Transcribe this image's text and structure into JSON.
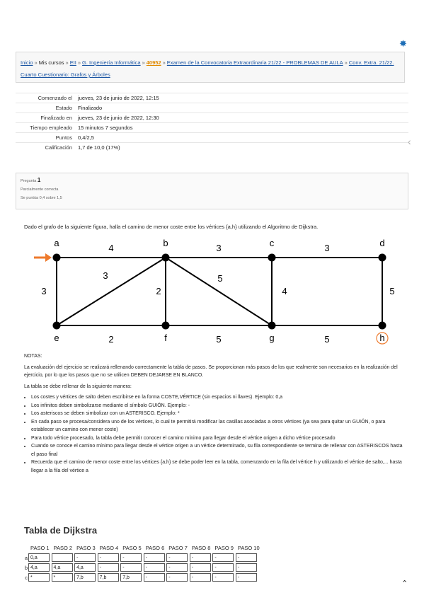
{
  "breadcrumb": {
    "items": [
      {
        "text": "Inicio",
        "link": true
      },
      {
        "text": "Mis cursos",
        "link": false
      },
      {
        "text": "EII",
        "link": true
      },
      {
        "text": "G. Ingeniería Informática",
        "link": true
      },
      {
        "text": "40952",
        "link": true,
        "highlight": true
      },
      {
        "text": "Examen de la Convocatoria Extraordinaria 21/22 - PROBLEMAS DE AULA",
        "link": true
      },
      {
        "text": "Conv. Extra. 21/22. Cuarto Cuestionario: Grafos y Árboles",
        "link": true
      }
    ],
    "separator": "»"
  },
  "summary": [
    {
      "label": "Comenzado el",
      "value": "jueves, 23 de junio de 2022, 12:15"
    },
    {
      "label": "Estado",
      "value": "Finalizado"
    },
    {
      "label": "Finalizado en",
      "value": "jueves, 23 de junio de 2022, 12:30"
    },
    {
      "label": "Tiempo empleado",
      "value": "15 minutos 7 segundos"
    },
    {
      "label": "Puntos",
      "value": "0,4/2,5"
    },
    {
      "label": "Calificación",
      "value": "1,7 de 10,0 (17%)"
    }
  ],
  "question_info": {
    "label": "Pregunta",
    "number": "1",
    "status": "Parcialmente correcta",
    "score": "Se puntúa 0,4 sobre 1,5"
  },
  "question_text": "Dado el grafo de la siguiente figura, halla el camino de menor coste entre los vértices {a,h} utilizando el Algoritmo de Dijkstra.",
  "graph": {
    "nodes": [
      "a",
      "b",
      "c",
      "d",
      "e",
      "f",
      "g",
      "h"
    ],
    "edges": [
      {
        "from": "a",
        "to": "b",
        "w": "4"
      },
      {
        "from": "b",
        "to": "c",
        "w": "3"
      },
      {
        "from": "c",
        "to": "d",
        "w": "3"
      },
      {
        "from": "a",
        "to": "e",
        "w": "3"
      },
      {
        "from": "e",
        "to": "b",
        "w": "3"
      },
      {
        "from": "b",
        "to": "f",
        "w": "2"
      },
      {
        "from": "b",
        "to": "g",
        "w": "5"
      },
      {
        "from": "c",
        "to": "g",
        "w": "4"
      },
      {
        "from": "d",
        "to": "h",
        "w": "5"
      },
      {
        "from": "e",
        "to": "f",
        "w": "2"
      },
      {
        "from": "f",
        "to": "g",
        "w": "5"
      },
      {
        "from": "g",
        "to": "h",
        "w": "5"
      }
    ],
    "start_node": "a",
    "end_node": "h",
    "colors": {
      "arrow": "#ee7a2c",
      "end_circle": "#ee7a2c"
    }
  },
  "notes": {
    "heading": "NOTAS:",
    "paragraph": "La evaluación del ejercicio se realizará rellenando correctamente la tabla de pasos. Se proporcionan más pasos de los que realmente son necesarios en la realización del ejercicio, por lo que los pasos que no se utilicen DEBEN DEJARSE EN BLANCO.",
    "subheading": "La tabla se debe rellenar de la siguiente manera:",
    "items": [
      "Los costes y vértices de salto deben escribirse en la forma COSTE,VÉRTICE (sin espacios ni llaves). Ejemplo: 0,a",
      "Los infinitos deben simbolizarse mediante el símbolo GUIÓN. Ejemplo: -",
      "Los asteriscos se deben simbolizar con un ASTERISCO. Ejemplo: *",
      "En cada paso se procesa/considera uno de los vértices, lo cual te permitirá modificar las casillas asociadas a otros vértices (ya sea para quitar un GUIÓN, o para establecer un camino con menor coste)",
      "Para todo vértice procesado, la tabla debe permitir conocer el camino mínimo para llegar desde el vértice origen a dicho vértice procesado",
      "Cuando se conoce el camino mínimo para llegar desde el vértice origen a un vértice determinado, su fila correspondiente se termina de rellenar con ASTERISCOS hasta el paso final",
      "Recuerda que el camino de menor coste entre los vértices {a,h} se debe poder leer en la tabla, comenzando en la fila del vértice h y utilizando el vértice de salto,... hasta llegar a la fila del vértice a"
    ]
  },
  "dijkstra": {
    "title": "Tabla de Dijkstra",
    "columns": [
      "PASO 1",
      "PASO 2",
      "PASO 3",
      "PASO 4",
      "PASO 5",
      "PASO 6",
      "PASO 7",
      "PASO 8",
      "PASO 9",
      "PASO 10"
    ],
    "rows": [
      {
        "label": "a",
        "cells": [
          "0,a",
          "",
          "-",
          "-",
          "-",
          "-",
          "-",
          "-",
          "-",
          "-"
        ]
      },
      {
        "label": "b",
        "cells": [
          "4,a",
          "4,a",
          "4,a",
          "-",
          "-",
          "-",
          "-",
          "-",
          "-",
          "-"
        ]
      },
      {
        "label": "c",
        "cells": [
          "*",
          "*",
          "7,b",
          "7,b",
          "7,b",
          "-",
          "-",
          "-",
          "-",
          "-"
        ]
      }
    ]
  }
}
